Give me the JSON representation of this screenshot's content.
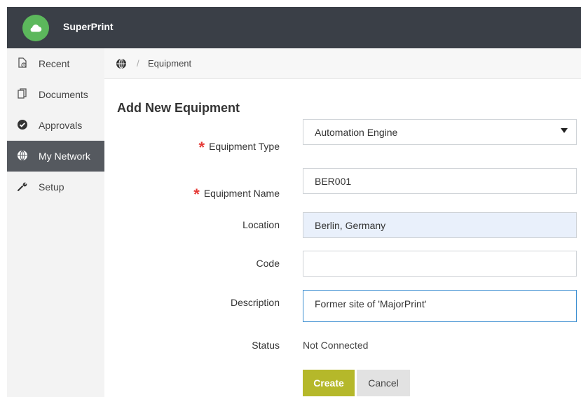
{
  "app": {
    "title": "SuperPrint"
  },
  "sidebar": {
    "items": [
      {
        "label": "Recent",
        "icon": "file-clock-icon",
        "active": false
      },
      {
        "label": "Documents",
        "icon": "documents-icon",
        "active": false
      },
      {
        "label": "Approvals",
        "icon": "check-circle-icon",
        "active": false
      },
      {
        "label": "My Network",
        "icon": "globe-icon",
        "active": true
      },
      {
        "label": "Setup",
        "icon": "wrench-icon",
        "active": false
      }
    ]
  },
  "breadcrumb": {
    "icon": "globe-icon",
    "separator": "/",
    "current": "Equipment"
  },
  "form": {
    "title": "Add New Equipment",
    "fields": {
      "equipment_type": {
        "label": "Equipment Type",
        "required": true,
        "value": "Automation Engine"
      },
      "equipment_name": {
        "label": "Equipment Name",
        "required": true,
        "value": "BER001"
      },
      "location": {
        "label": "Location",
        "value": "Berlin, Germany"
      },
      "code": {
        "label": "Code",
        "value": ""
      },
      "description": {
        "label": "Description",
        "value": "Former site of 'MajorPrint'"
      },
      "status": {
        "label": "Status",
        "value": "Not Connected"
      }
    },
    "required_marker": "*",
    "buttons": {
      "create": "Create",
      "cancel": "Cancel"
    }
  },
  "colors": {
    "topbar": "#3a3f47",
    "logo": "#5cb85c",
    "active_nav": "#55595f",
    "create_button": "#b5b82a",
    "required": "#e53935",
    "focus_border": "#3d8fd1"
  }
}
